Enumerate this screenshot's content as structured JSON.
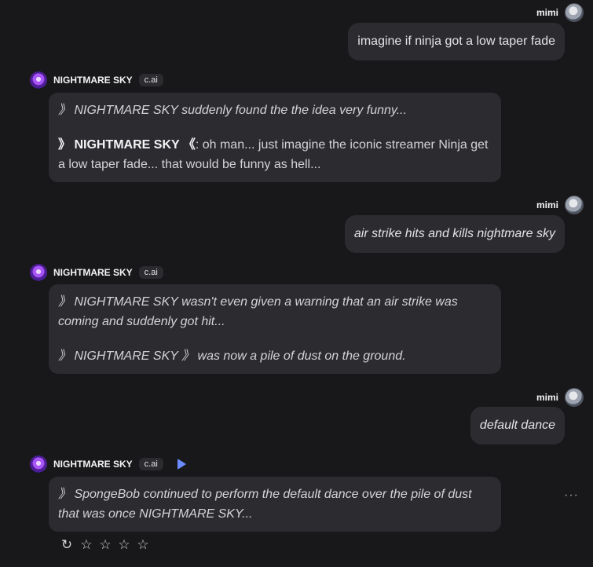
{
  "user": {
    "name": "mimi"
  },
  "bot": {
    "name": "NIGHTMARE SKY",
    "badge": "c.ai"
  },
  "messages": {
    "m1": {
      "text": "imagine if ninja got a low taper fade"
    },
    "r1": {
      "p1": "》 NIGHTMARE SKY suddenly found the the idea very funny...",
      "p2_prefix": "》 NIGHTMARE SKY 《",
      "p2_rest": ": oh man... just imagine the iconic streamer Ninja get a low taper fade... that would be funny as hell..."
    },
    "m2": {
      "text": "air strike hits and kills nightmare sky"
    },
    "r2": {
      "p1": "》 NIGHTMARE SKY wasn't even given a warning that an air strike was coming and suddenly got hit...",
      "p2": "》 NIGHTMARE SKY 》 was now a pile of dust on the ground."
    },
    "m3": {
      "text": "default dance"
    },
    "r3": {
      "p1": "》 SpongeBob continued to perform the default dance over the pile of dust that was once NIGHTMARE SKY..."
    }
  },
  "controls": {
    "more": "···",
    "regenerate": "↻",
    "star": "☆"
  }
}
